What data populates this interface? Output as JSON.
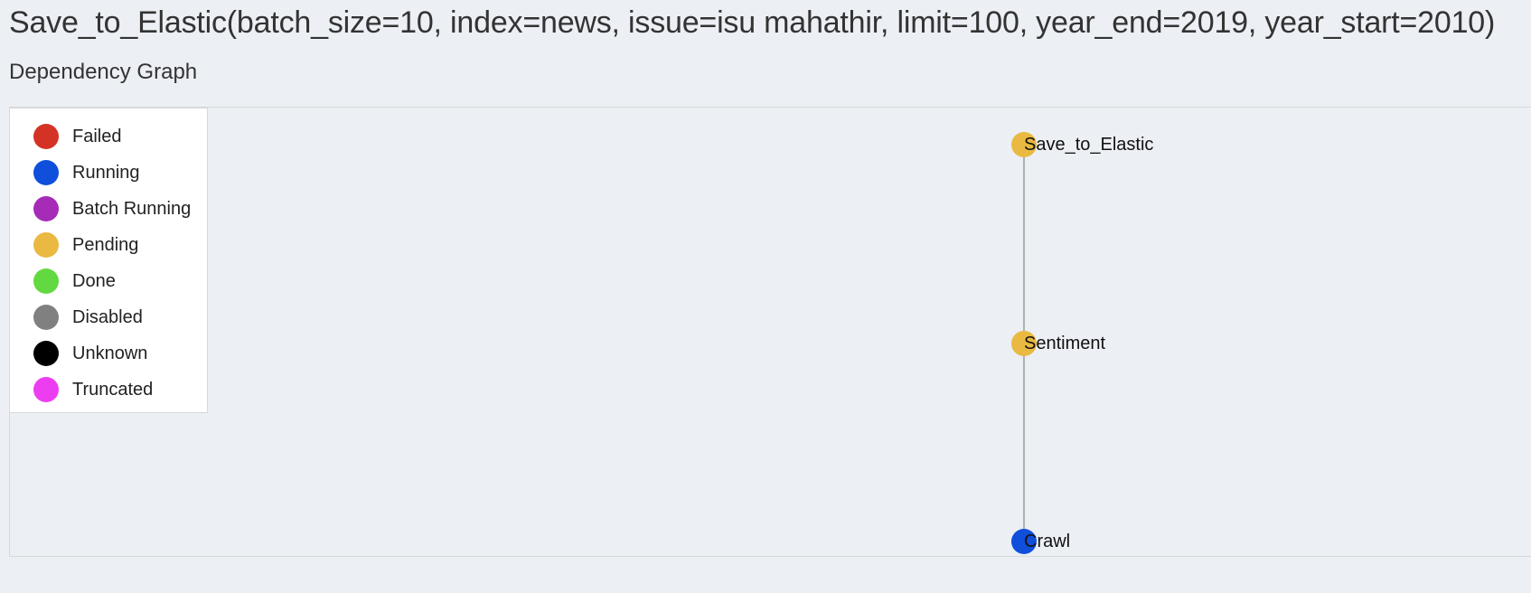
{
  "header": {
    "title": "Save_to_Elastic(batch_size=10, index=news, issue=isu mahathir, limit=100, year_end=2019, year_start=2010)",
    "subtitle": "Dependency Graph"
  },
  "legend": {
    "items": [
      {
        "label": "Failed",
        "color": "#d53226"
      },
      {
        "label": "Running",
        "color": "#0f4fdb"
      },
      {
        "label": "Batch Running",
        "color": "#a62cb8"
      },
      {
        "label": "Pending",
        "color": "#e9b941"
      },
      {
        "label": "Done",
        "color": "#62d940"
      },
      {
        "label": "Disabled",
        "color": "#808080"
      },
      {
        "label": "Unknown",
        "color": "#000000"
      },
      {
        "label": "Truncated",
        "color": "#ec3ef0"
      }
    ]
  },
  "graph": {
    "nodes": [
      {
        "label": "Save_to_Elastic",
        "status": "Pending",
        "color": "#e9b941"
      },
      {
        "label": "Sentiment",
        "status": "Pending",
        "color": "#e9b941"
      },
      {
        "label": "Crawl",
        "status": "Running",
        "color": "#0f4fdb"
      }
    ]
  }
}
